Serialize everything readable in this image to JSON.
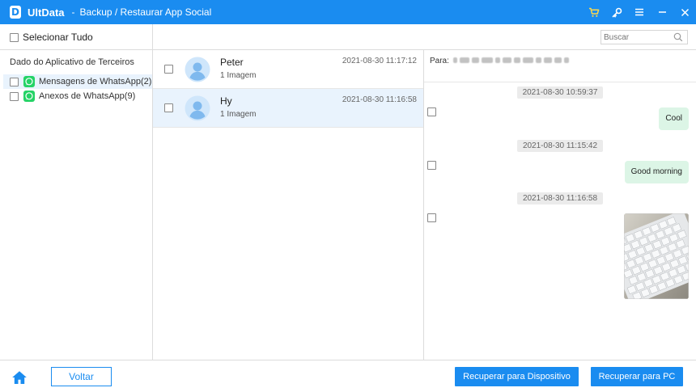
{
  "window": {
    "app_name": "UltData",
    "separator": "-",
    "title": "Backup / Restaurar App Social",
    "accent_color": "#1a8cf0",
    "actions": [
      "cart-icon",
      "key-icon",
      "menu-icon",
      "minimize-icon",
      "close-icon"
    ]
  },
  "toolbar": {
    "select_all_label": "Selecionar Tudo",
    "search_placeholder": "Buscar"
  },
  "sidebar": {
    "heading": "Dado do Aplicativo de Terceiros",
    "items": [
      {
        "label": "Mensagens de WhatsApp(2)",
        "checked": false,
        "active": true,
        "icon": "whatsapp-icon"
      },
      {
        "label": "Anexos de WhatsApp(9)",
        "checked": false,
        "active": false,
        "icon": "whatsapp-icon"
      }
    ]
  },
  "chats": [
    {
      "name": "Peter",
      "subtitle": "1 Imagem",
      "time": "2021-08-30 11:17:12",
      "selected": false
    },
    {
      "name": "Hy",
      "subtitle": "1 Imagem",
      "time": "2021-08-30 11:16:58",
      "selected": true
    }
  ],
  "detail": {
    "to_label": "Para:",
    "messages": [
      {
        "time": "2021-08-30 10:59:37",
        "text": "Cool",
        "type": "text"
      },
      {
        "time": "2021-08-30 11:15:42",
        "text": "Good morning",
        "type": "text"
      },
      {
        "time": "2021-08-30 11:16:58",
        "type": "image"
      }
    ],
    "bubble_color": "#dcf5e6"
  },
  "footer": {
    "back_label": "Voltar",
    "recover_device_label": "Recuperar para Dispositivo",
    "recover_pc_label": "Recuperar para PC"
  }
}
